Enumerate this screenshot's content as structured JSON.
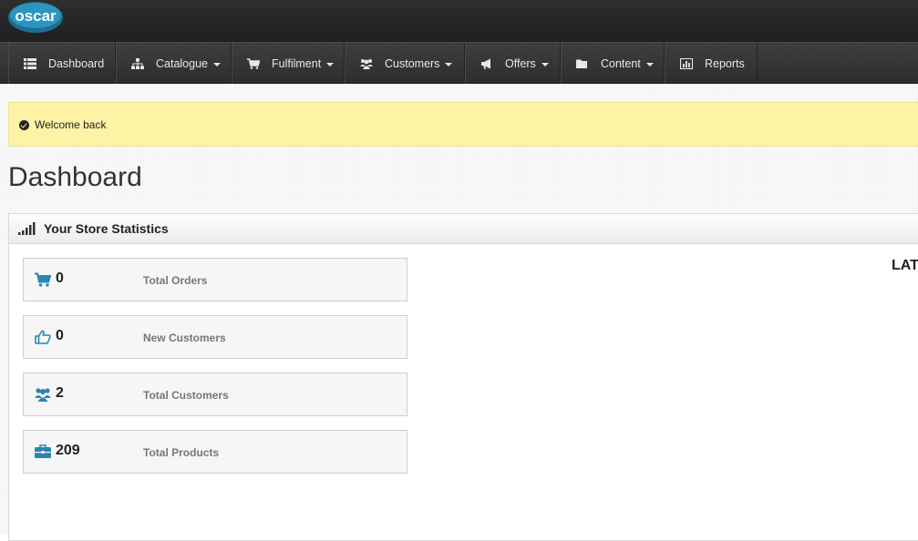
{
  "brand": {
    "logo_text": "oscar"
  },
  "nav": {
    "items": [
      {
        "label": "Dashboard",
        "icon": "list-icon",
        "has_caret": false
      },
      {
        "label": "Catalogue",
        "icon": "sitemap-icon",
        "has_caret": true
      },
      {
        "label": "Fulfilment",
        "icon": "cart-icon",
        "has_caret": true
      },
      {
        "label": "Customers",
        "icon": "group-icon",
        "has_caret": true
      },
      {
        "label": "Offers",
        "icon": "bullhorn-icon",
        "has_caret": true
      },
      {
        "label": "Content",
        "icon": "folder-icon",
        "has_caret": true
      },
      {
        "label": "Reports",
        "icon": "bar-chart-icon",
        "has_caret": false
      }
    ]
  },
  "alert": {
    "message": "Welcome back"
  },
  "page": {
    "title": "Dashboard"
  },
  "stats_panel": {
    "title": "Your Store Statistics",
    "items": [
      {
        "value": "0",
        "label": "Total Orders",
        "icon": "cart-icon"
      },
      {
        "value": "0",
        "label": "New Customers",
        "icon": "thumbs-up-icon"
      },
      {
        "value": "2",
        "label": "Total Customers",
        "icon": "group-icon"
      },
      {
        "value": "209",
        "label": "Total Products",
        "icon": "briefcase-icon"
      }
    ],
    "latest_heading": "LAT"
  },
  "colors": {
    "accent_icon": "#2a86b3",
    "alert_bg": "#fcf3a5",
    "nav_bg": "#333333"
  }
}
